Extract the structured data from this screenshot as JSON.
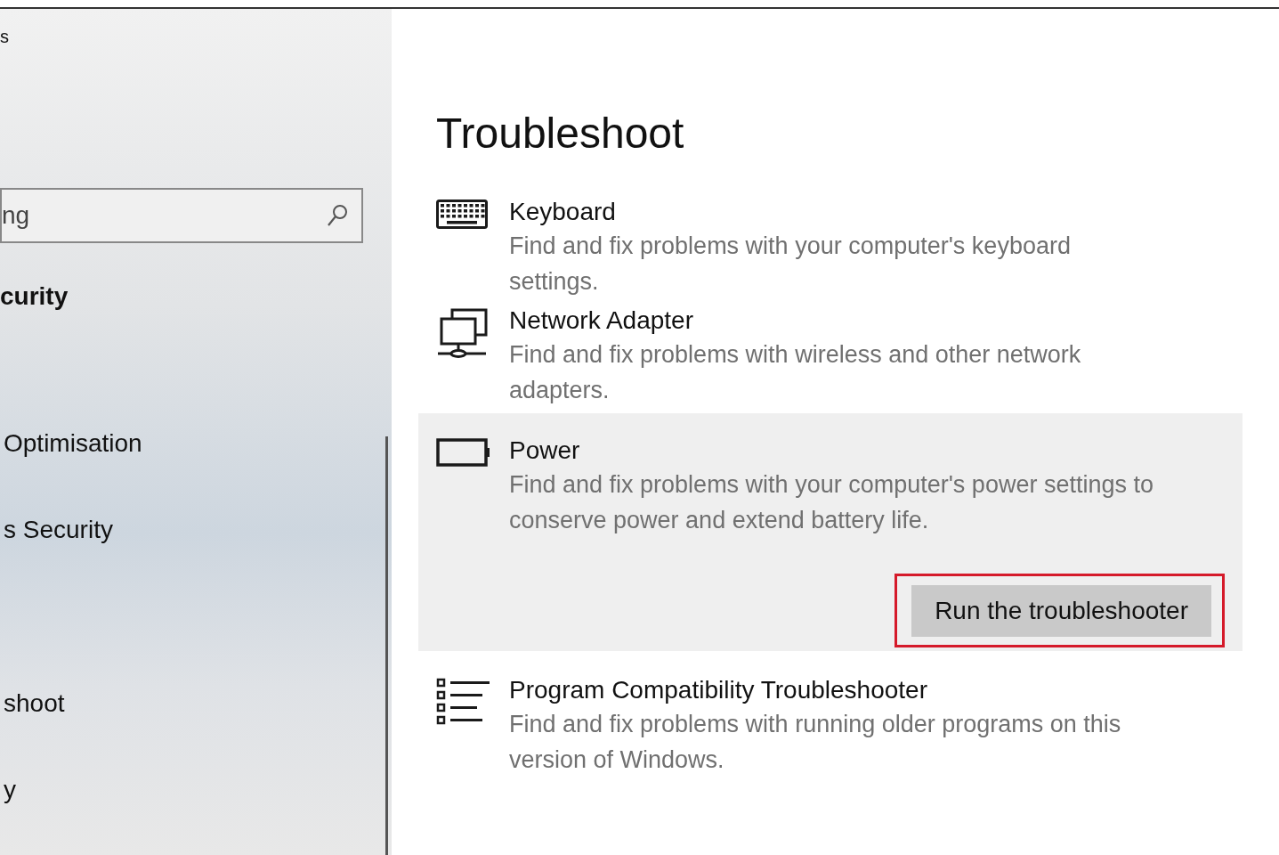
{
  "sidebar": {
    "title": "s",
    "search": {
      "placeholder": "ng"
    },
    "heading": "curity",
    "items": [
      {
        "label": "Optimisation"
      },
      {
        "label": "s Security"
      },
      {
        "label": "shoot"
      },
      {
        "label": "y"
      }
    ]
  },
  "main": {
    "title": "Troubleshoot",
    "items": [
      {
        "title": "Keyboard",
        "description": "Find and fix problems with your computer's keyboard settings.",
        "selected": false
      },
      {
        "title": "Network Adapter",
        "description": "Find and fix problems with wireless and other network adapters.",
        "selected": false
      },
      {
        "title": "Power",
        "description": "Find and fix problems with your computer's power settings to conserve power and extend battery life.",
        "selected": true,
        "button": {
          "label": "Run the troubleshooter",
          "highlighted": true
        }
      },
      {
        "title": "Program Compatibility Troubleshooter",
        "description": "Find and fix problems with running older programs on this version of Windows.",
        "selected": false
      }
    ]
  }
}
